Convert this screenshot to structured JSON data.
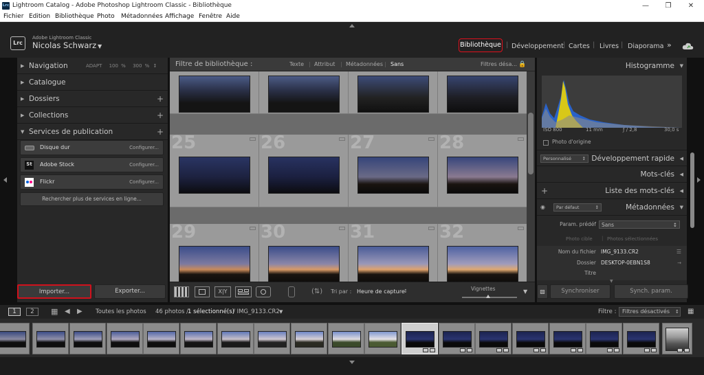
{
  "window": {
    "app_badge": "Lrc",
    "title": "Lightroom Catalog - Adobe Photoshop Lightroom Classic - Bibliothèque"
  },
  "menu": [
    "Fichier",
    "Edition",
    "Bibliothèque",
    "Photo",
    "Métadonnées",
    "Affichage",
    "Fenêtre",
    "Aide"
  ],
  "identity": {
    "logo": "Lrc",
    "product": "Adobe Lightroom Classic",
    "user": "Nicolas Schwarz"
  },
  "modules": [
    "Bibliothèque",
    "Développement",
    "Cartes",
    "Livres",
    "Diaporama"
  ],
  "more_modules": "»",
  "left": {
    "navigation": "Navigation",
    "nav_zoom": [
      "ADAPT",
      "100 %",
      "300 %"
    ],
    "catalogue": "Catalogue",
    "dossiers": "Dossiers",
    "collections": "Collections",
    "services": "Services de publication",
    "publish": [
      {
        "name": "Disque dur",
        "configure": "Configurer..."
      },
      {
        "name": "Adobe Stock",
        "configure": "Configurer..."
      },
      {
        "name": "Flickr",
        "configure": "Configurer..."
      }
    ],
    "adobe_stock_badge": "St",
    "find_more": "Rechercher plus de services en ligne...",
    "import": "Importer...",
    "export": "Exporter..."
  },
  "filterbar": {
    "title": "Filtre de bibliothèque :",
    "options": [
      "Texte",
      "Attribut",
      "Métadonnées",
      "Sans"
    ],
    "disabled": "Filtres désa..."
  },
  "grid": {
    "numbers": [
      "25",
      "26",
      "27",
      "28",
      "29",
      "30",
      "31",
      "32"
    ]
  },
  "toolbar": {
    "view_compare": "X|Y",
    "sort_label": "Tri par :",
    "sort_value": "Heure de capture",
    "thumbs_label": "Vignettes"
  },
  "right": {
    "histogram": "Histogramme",
    "iso": "ISO 800",
    "focal": "11 mm",
    "aperture": "ƒ / 2,8",
    "shutter": "30,0 s",
    "original_photo": "Photo d'origine",
    "preset_select": "Personnalisé",
    "quick_develop": "Développement rapide",
    "keywords": "Mots-clés",
    "keyword_list": "Liste des mots-clés",
    "keyword_plus": "+",
    "metadata_select": "Par défaut",
    "metadata": "Métadonnées",
    "preset_label": "Param. prédéf",
    "preset_value": "Sans",
    "photo_cible": "Photo cible",
    "photos_selected": "Photos sélectionnées",
    "filename_label": "Nom du fichier",
    "filename_value": "IMG_9133.CR2",
    "folder_label": "Dossier",
    "folder_value": "DESKTOP-0EBN1S8",
    "title_label": "Titre",
    "sync": "Synchroniser",
    "sync_settings": "Synch. param."
  },
  "filmstrip_bar": {
    "page1": "1",
    "page2": "2",
    "source": "Toutes les photos",
    "count": "46 photos /",
    "selected": "1 sélectionné(s)",
    "file": "/ IMG_9133.CR2",
    "filter_label": "Filtre :",
    "filter_value": "Filtres désactivés"
  },
  "colors": {
    "accent_red": "#e0101d",
    "panel": "#282828",
    "grid_bg": "#6b6b6b",
    "cell_bg": "#9a9a9a",
    "histogram_blue": "#3a78d8",
    "histogram_yellow": "#e6d21e"
  },
  "icons": {
    "navigation_expand": "triangle-right-icon",
    "services_expand": "triangle-down-icon",
    "lock": "lock-icon",
    "cloud": "cloud-icon",
    "grid_view": "grid-view-icon",
    "loupe_view": "loupe-view-icon",
    "survey_view": "survey-view-icon",
    "people_view": "people-view-icon",
    "spray": "painter-icon",
    "sort_direction": "sort-direction-icon",
    "filmstrip_grid": "grid-icon",
    "back": "arrow-left-icon",
    "forward": "arrow-right-icon"
  }
}
